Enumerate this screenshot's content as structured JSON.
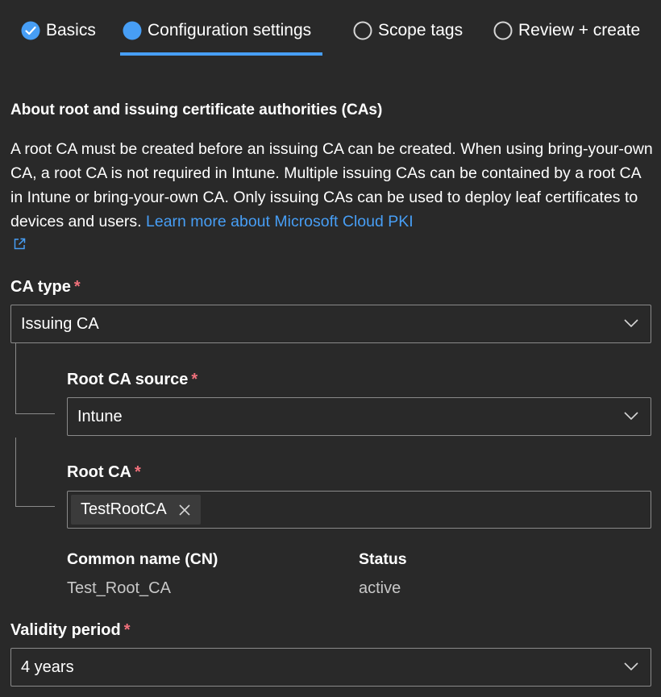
{
  "tabs": [
    {
      "label": "Basics",
      "state": "complete"
    },
    {
      "label": "Configuration settings",
      "state": "active"
    },
    {
      "label": "Scope tags",
      "state": "pending"
    },
    {
      "label": "Review + create",
      "state": "pending"
    }
  ],
  "about": {
    "heading": "About root and issuing certificate authorities (CAs)",
    "body": "A root CA must be created before an issuing CA can be created. When using bring-your-own CA, a root CA is not required in Intune. Multiple issuing CAs can be contained by a root CA in Intune or bring-your-own CA. Only issuing CAs can be used to deploy leaf certificates to devices and users.",
    "link": "Learn more about Microsoft Cloud PKI"
  },
  "ca_type": {
    "label": "CA type",
    "required": "*",
    "value": "Issuing CA"
  },
  "root_ca_source": {
    "label": "Root CA source",
    "required": "*",
    "value": "Intune"
  },
  "root_ca": {
    "label": "Root CA",
    "required": "*",
    "chip": "TestRootCA"
  },
  "details": {
    "cn_label": "Common name (CN)",
    "cn_value": "Test_Root_CA",
    "status_label": "Status",
    "status_value": "active"
  },
  "validity": {
    "label": "Validity period",
    "required": "*",
    "value": "4 years"
  },
  "colors": {
    "accent": "#479ef5",
    "required": "#f1707b",
    "background": "#292929",
    "border": "#8a8a8a"
  }
}
